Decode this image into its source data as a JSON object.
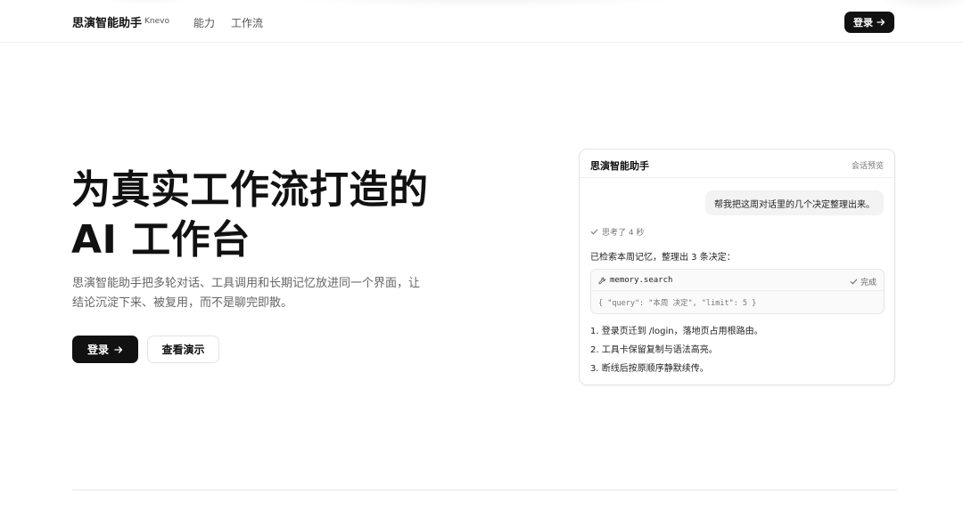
{
  "header": {
    "brand": "思演智能助手",
    "brand_sub": "Knevo",
    "nav": [
      "能力",
      "工作流"
    ],
    "login_label": "登录"
  },
  "hero": {
    "title_line1": "为真实工作流打造的",
    "title_line2": "AI 工作台",
    "description": "思演智能助手把多轮对话、工具调用和长期记忆放进同一个界面，让结论沉淀下来、被复用，而不是聊完即散。",
    "primary_label": "登录",
    "secondary_label": "查看演示"
  },
  "preview": {
    "title": "思演智能助手",
    "tag": "会话预览",
    "user_message": "帮我把这周对话里的几个决定整理出来。",
    "thinking": "思考了 4 秒",
    "reply_intro": "已检索本周记忆，整理出 3 条决定：",
    "tool": {
      "name": "memory.search",
      "status": "完成",
      "args": "{ \"query\": \"本周 决定\", \"limit\": 5 }"
    },
    "items": [
      "1. 登录页迁到 /login，落地页占用根路由。",
      "2. 工具卡保留复制与语法高亮。",
      "3. 断线后按原顺序静默续传。"
    ]
  },
  "icons": {
    "arrow": "arrow-right-icon",
    "check": "check-icon",
    "tool": "wrench-icon"
  },
  "colors": {
    "primary": "#111111",
    "muted": "#666666",
    "border": "#e4e4e4"
  }
}
